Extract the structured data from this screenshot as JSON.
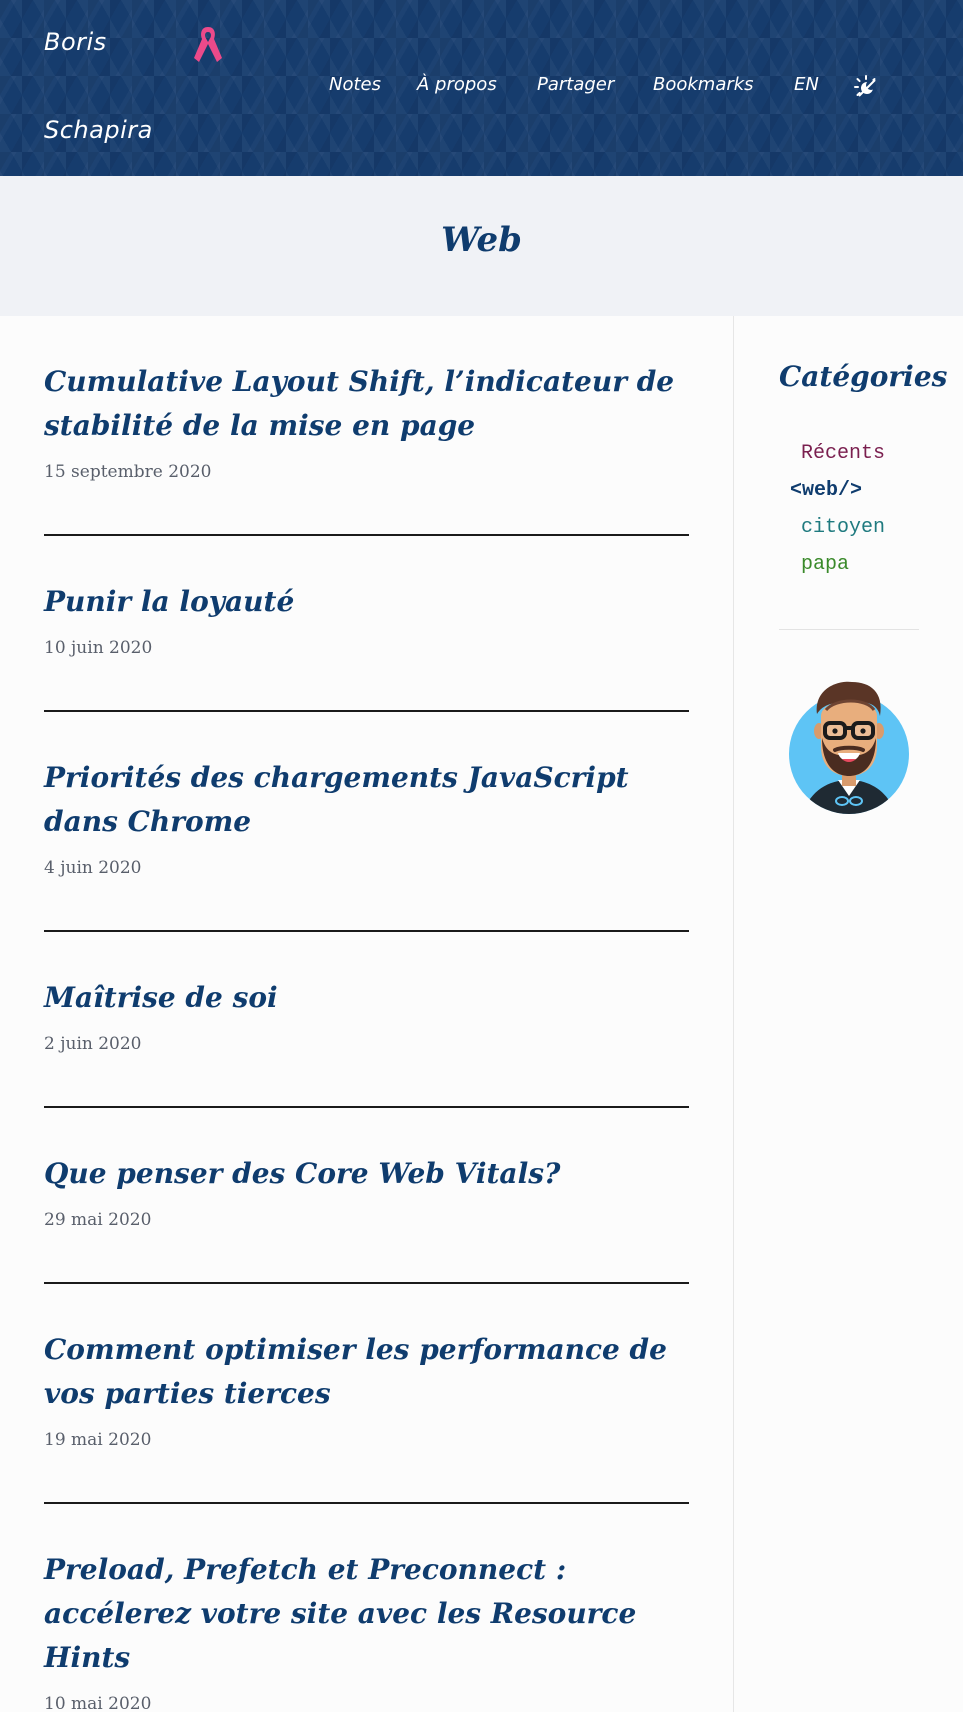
{
  "header": {
    "brand_first": "Boris",
    "brand_last": "Schapira",
    "ribbon_icon": "pink-ribbon-icon",
    "nav": [
      {
        "label": "Notes"
      },
      {
        "label": "À propos"
      },
      {
        "label": "Partager"
      },
      {
        "label": "Bookmarks"
      },
      {
        "label": "EN"
      }
    ],
    "theme_icon": "sun-moon-icon"
  },
  "category": {
    "title": "Web"
  },
  "posts": [
    {
      "title": "Cumulative Layout Shift, l’indicateur de stabilité de la mise en page",
      "date": "15 septembre 2020"
    },
    {
      "title": "Punir la loyauté",
      "date": "10 juin 2020"
    },
    {
      "title": "Priorités des chargements JavaScript dans Chrome",
      "date": "4 juin 2020"
    },
    {
      "title": "Maîtrise de soi",
      "date": "2 juin 2020"
    },
    {
      "title": "Que penser des Core Web Vitals?",
      "date": "29 mai 2020"
    },
    {
      "title": "Comment optimiser les performance de vos parties tierces",
      "date": "19 mai 2020"
    },
    {
      "title": "Preload, Prefetch et Preconnect : accélerez votre site avec les Resource Hints",
      "date": "10 mai 2020"
    }
  ],
  "sidebar": {
    "title": "Catégories",
    "categories": [
      {
        "label": "Récents",
        "color": "#7a1f4f"
      },
      {
        "label": "<web/>",
        "color": "#0f3c6e"
      },
      {
        "label": "citoyen",
        "color": "#1f7a7f"
      },
      {
        "label": "papa",
        "color": "#3a8a2a"
      }
    ],
    "avatar_icon": "avatar-illustration"
  },
  "colors": {
    "header_bg": "#163c6d",
    "accent": "#0f3c6e",
    "ribbon": "#ec4a8a",
    "banner_bg": "#f0f2f6"
  }
}
